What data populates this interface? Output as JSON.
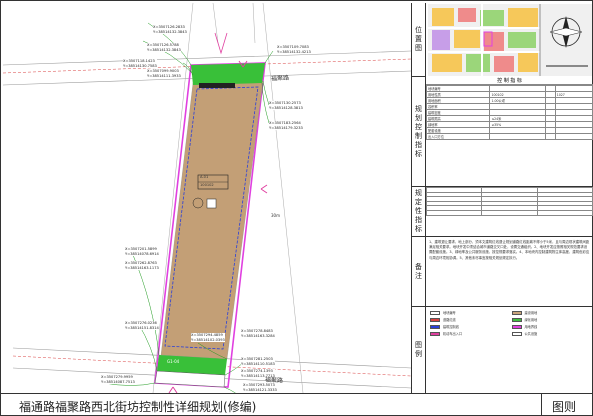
{
  "footer": {
    "title": "福通路福聚路西北街坊控制性详细规划(修编)",
    "tag": "图则"
  },
  "panel": {
    "location_label": "位置图",
    "control_label": "控制指标",
    "guide_label": "规划控制指标",
    "design_label": "规定性指标",
    "note_label": "备注",
    "legend_label": "图例",
    "index_title": "控 制 指 标",
    "index_rows": [
      [
        "地块编号",
        "",
        "",
        ""
      ],
      [
        "用地性质",
        "100102",
        "",
        "1027"
      ],
      [
        "用地面积",
        "1.00公顷",
        "",
        ""
      ],
      [
        "容积率",
        "",
        "",
        ""
      ],
      [
        "建筑密度",
        "",
        "",
        ""
      ],
      [
        "建筑限高",
        "≤24米",
        "",
        ""
      ],
      [
        "绿地率",
        "≥35%",
        "",
        ""
      ],
      [
        "配套设施",
        "",
        "",
        ""
      ],
      [
        "出入口方位",
        "",
        "",
        ""
      ]
    ],
    "notes": "1、建筑退让要求，地上部分，须本文建筑红线退让规划道路红线距离不得小于5米，且与周边现状建筑间距满足相关要求。地块开发中须结合城市道路交叉口处，设置交通组织。2、地块开发应按照相关规范要求设置配套设施。3、绿地率及公共服务设施，按控规要求落实。4、本地块内控制建筑物主体高度，建筑色彩应与周边环境相协调。5、其他未尽事宜按相关规划规定执行。",
    "legend": [
      {
        "label": "地块编号",
        "color": "#ffffff"
      },
      {
        "label": "建设用地",
        "color": "#c9a57c"
      },
      {
        "label": "道路红线",
        "color": "#d94040"
      },
      {
        "label": "绿化用地",
        "color": "#3fbf3f"
      },
      {
        "label": "建筑控制线",
        "color": "#2a3fd9"
      },
      {
        "label": "用地界线",
        "color": "#e040e0"
      },
      {
        "label": "机动车出入口",
        "color": "#e040a0"
      },
      {
        "label": "公共设施",
        "color": "#ffffff"
      }
    ]
  },
  "map": {
    "parcel_code": "A-01",
    "parcel_use": "100102",
    "road_top": "福聚路",
    "road_bottom": "福聚路",
    "road_right": "路",
    "width_label": "30m",
    "green_top_label": "G1",
    "green_bottom_label": "G1-04",
    "coords": [
      "X=3507126.2833\nY=38514132.3843",
      "X=3507126.5788\nY=38514132.3843",
      "X=3507118.1423\nY=38514130.7583",
      "X=3507099.9003\nY=38514111.3933",
      "X=3507109.7083\nY=38514132.4213",
      "X=3507130.2573\nY=38514128.3813",
      "X=3507183.2564\nY=38514179.3233",
      "X=3507201.5899\nY=38514078.6914",
      "X=3507262.8763\nY=38514163.1173",
      "X=3507276.0236\nY=38514151.8314",
      "X=3507294.4859\nY=38514102.0393",
      "X=3507278.8483\nY=38514163.3284",
      "X=3507281.2503\nY=38514110.5183",
      "X=3507279.9959\nY=38514087.7513",
      "X=3507274.1393\nY=38514113.7713",
      "X=3507293.5073\nY=38514121.3333"
    ]
  }
}
